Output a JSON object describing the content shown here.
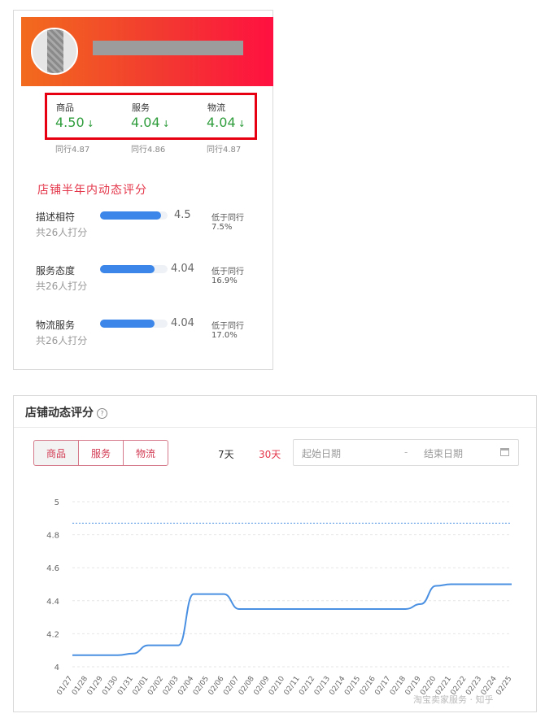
{
  "shop_card": {
    "ratings": [
      {
        "label": "商品",
        "value": "4.50",
        "arrow": "↓",
        "peer": "同行4.87"
      },
      {
        "label": "服务",
        "value": "4.04",
        "arrow": "↓",
        "peer": "同行4.86"
      },
      {
        "label": "物流",
        "value": "4.04",
        "arrow": "↓",
        "peer": "同行4.87"
      }
    ],
    "half_year_title": "店铺半年内动态评分",
    "details": [
      {
        "name": "描述相符",
        "count": "共26人打分",
        "score": "4.5",
        "score_value": 4.5,
        "compare": "低于同行",
        "percent": "7.5%"
      },
      {
        "name": "服务态度",
        "count": "共26人打分",
        "score": "4.04",
        "score_value": 4.04,
        "compare": "低于同行",
        "percent": "16.9%"
      },
      {
        "name": "物流服务",
        "count": "共26人打分",
        "score": "4.04",
        "score_value": 4.04,
        "compare": "低于同行",
        "percent": "17.0%"
      }
    ],
    "colors": {
      "banner_start": "#f26b1d",
      "banner_end": "#ff1040",
      "highlight_border": "#e60012",
      "rating_green": "#2f9d3c",
      "bar_blue": "#3b86e8"
    }
  },
  "dynamic_panel": {
    "title": "店铺动态评分",
    "help_icon": "?",
    "tabs": [
      {
        "label": "商品",
        "active": true
      },
      {
        "label": "服务",
        "active": false
      },
      {
        "label": "物流",
        "active": false
      }
    ],
    "range_7": "7天",
    "range_30": "30天",
    "date_start_placeholder": "起始日期",
    "date_separator": "-",
    "date_end_placeholder": "结束日期",
    "accent_color": "#e4364a"
  },
  "chart_data": {
    "type": "line",
    "title": "",
    "xlabel": "",
    "ylabel": "",
    "ylim": [
      4,
      5
    ],
    "yticks": [
      4,
      4.2,
      4.4,
      4.6,
      4.8,
      5
    ],
    "grid": true,
    "x": [
      "01/27",
      "01/28",
      "01/29",
      "01/30",
      "01/31",
      "02/01",
      "02/02",
      "02/03",
      "02/04",
      "02/05",
      "02/06",
      "02/07",
      "02/08",
      "02/09",
      "02/10",
      "02/11",
      "02/12",
      "02/13",
      "02/14",
      "02/15",
      "02/16",
      "02/17",
      "02/18",
      "02/19",
      "02/20",
      "02/21",
      "02/22",
      "02/23",
      "02/24",
      "02/25"
    ],
    "series": [
      {
        "values": [
          4.07,
          4.07,
          4.07,
          4.07,
          4.08,
          4.13,
          4.13,
          4.13,
          4.44,
          4.44,
          4.44,
          4.35,
          4.35,
          4.35,
          4.35,
          4.35,
          4.35,
          4.35,
          4.35,
          4.35,
          4.35,
          4.35,
          4.35,
          4.38,
          4.49,
          4.5,
          4.5,
          4.5,
          4.5,
          4.5
        ],
        "color": "#4a90e2",
        "style": "solid"
      },
      {
        "values": [
          4.87,
          4.87,
          4.87,
          4.87,
          4.87,
          4.87,
          4.87,
          4.87,
          4.87,
          4.87,
          4.87,
          4.87,
          4.87,
          4.87,
          4.87,
          4.87,
          4.87,
          4.87,
          4.87,
          4.87,
          4.87,
          4.87,
          4.87,
          4.87,
          4.87,
          4.87,
          4.87,
          4.87,
          4.87,
          4.87
        ],
        "color": "#4a90e2",
        "style": "dashed"
      }
    ]
  },
  "watermark": "淘宝卖家服务 · 知乎"
}
